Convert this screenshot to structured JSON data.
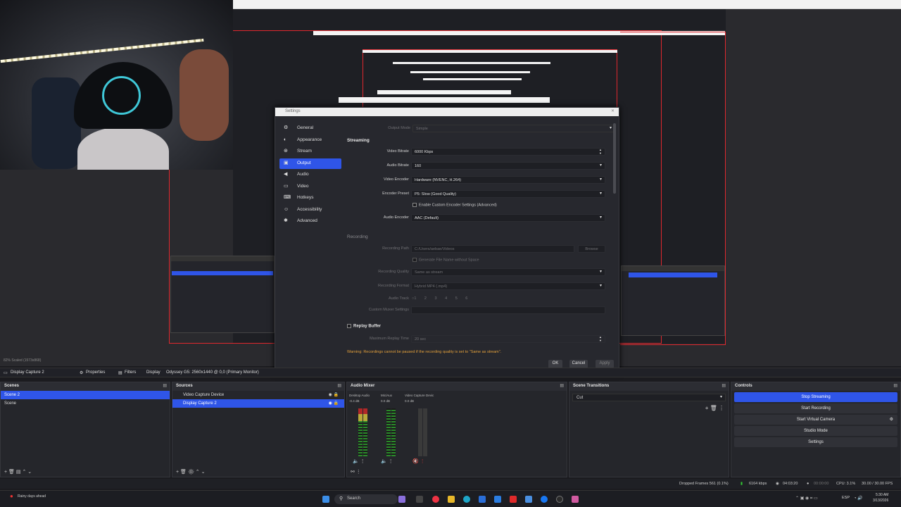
{
  "settings": {
    "title": "Settings",
    "nav": [
      {
        "label": "General",
        "icon": "gear-icon"
      },
      {
        "label": "Appearance",
        "icon": "palette-icon"
      },
      {
        "label": "Stream",
        "icon": "antenna-icon"
      },
      {
        "label": "Output",
        "icon": "output-icon"
      },
      {
        "label": "Audio",
        "icon": "speaker-icon"
      },
      {
        "label": "Video",
        "icon": "monitor-icon"
      },
      {
        "label": "Hotkeys",
        "icon": "keyboard-icon"
      },
      {
        "label": "Accessibility",
        "icon": "accessibility-icon"
      },
      {
        "label": "Advanced",
        "icon": "wrench-icon"
      }
    ],
    "output_mode_label": "Output Mode",
    "output_mode_value": "Simple",
    "streaming_title": "Streaming",
    "video_bitrate_label": "Video Bitrate",
    "video_bitrate_value": "6000 Kbps",
    "audio_bitrate_label": "Audio Bitrate",
    "audio_bitrate_value": "160",
    "video_encoder_label": "Video Encoder",
    "video_encoder_value": "Hardware (NVENC, H.264)",
    "encoder_preset_label": "Encoder Preset",
    "encoder_preset_value": "P5: Slow (Good Quality)",
    "custom_encoder_label": "Enable Custom Encoder Settings (Advanced)",
    "audio_encoder_label": "Audio Encoder",
    "audio_encoder_value": "AAC (Default)",
    "recording_title": "Recording",
    "recording_path_label": "Recording Path",
    "recording_path_value": "C:/Users/aebae/Videos",
    "browse_label": "Browse",
    "gen_filename_label": "Generate File Name without Space",
    "recording_quality_label": "Recording Quality",
    "recording_quality_value": "Same as stream",
    "recording_format_label": "Recording Format",
    "recording_format_value": "Hybrid MP4 (.mp4)",
    "audio_track_label": "Audio Track",
    "audio_tracks": [
      "1",
      "2",
      "3",
      "4",
      "5",
      "6"
    ],
    "custom_muxer_label": "Custom Muxer Settings",
    "replay_buffer_label": "Replay Buffer",
    "max_replay_label": "Maximum Replay Time",
    "max_replay_value": "20 sec",
    "warning": "Warning: Recordings cannot be paused if the recording quality is set to \"Same as stream\".",
    "ok": "OK",
    "cancel": "Cancel",
    "apply": "Apply"
  },
  "source_bar": {
    "source": "Display Capture 2",
    "properties": "Properties",
    "filters": "Filters",
    "display_label": "Display",
    "display_value": "Odyssey G5: 2560x1440 @ 0,0 (Primary Monitor)"
  },
  "preview_status": "82%   Scaled (1573x868)",
  "scenes": {
    "title": "Scenes",
    "items": [
      "Scene 2",
      "Scene"
    ]
  },
  "sources": {
    "title": "Sources",
    "items": [
      "Video Capture Device",
      "Display Capture 2"
    ]
  },
  "mixer": {
    "title": "Audio Mixer",
    "channels": [
      {
        "name": "Desktop Audio",
        "db": "-0.4 dB"
      },
      {
        "name": "Mic/Aux",
        "db": "0.0 dB"
      },
      {
        "name": "Video Capture Devic",
        "db": "0.0 dB"
      }
    ]
  },
  "transitions": {
    "title": "Scene Transitions",
    "value": "Cut"
  },
  "controls": {
    "title": "Controls",
    "buttons": [
      "Stop Streaming",
      "Start Recording",
      "Start Virtual Camera",
      "Studio Mode",
      "Settings"
    ]
  },
  "status": {
    "dropped": "Dropped Frames 561 (0.1%)",
    "kbps": "6164 kbps",
    "stream_time": "04:03:20",
    "rec_time": "00:00:00",
    "cpu": "CPU: 3.1%",
    "fps": "30.00 / 30.00 FPS"
  },
  "taskbar": {
    "weather": "Rainy days ahead",
    "search": "Search",
    "lang": "ESP",
    "time": "5:30 AM",
    "date": "3/13/2026"
  },
  "colors": {
    "accent": "#2f55e8",
    "warning": "#e3a03b",
    "red_frame": "#e0282e"
  }
}
